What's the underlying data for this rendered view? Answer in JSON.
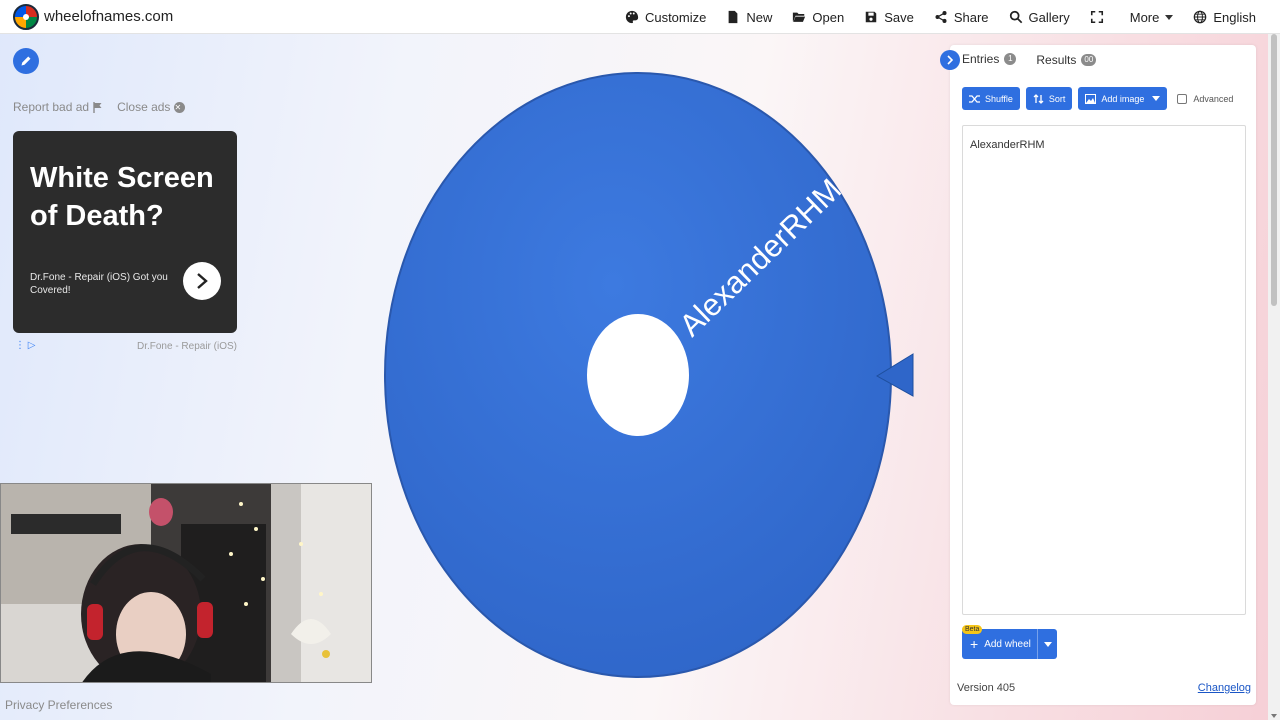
{
  "site": {
    "name": "wheelofnames.com"
  },
  "nav": {
    "customize": "Customize",
    "new": "New",
    "open": "Open",
    "save": "Save",
    "share": "Share",
    "gallery": "Gallery",
    "more": "More",
    "language": "English"
  },
  "ad": {
    "report": "Report bad ad",
    "close": "Close ads",
    "headline": "White Screen of Death?",
    "sub": "Dr.Fone - Repair (iOS) Got you Covered!",
    "advertiser": "Dr.Fone - Repair (iOS)"
  },
  "wheel": {
    "entry_label": "AlexanderRHM",
    "color": "#3b78d6"
  },
  "panel": {
    "tabs": [
      {
        "label": "Entries",
        "count": "1"
      },
      {
        "label": "Results",
        "count": "00"
      }
    ],
    "tools": {
      "shuffle": "Shuffle",
      "sort": "Sort",
      "add_image": "Add image",
      "advanced": "Advanced"
    },
    "entries": [
      "AlexanderRHM"
    ],
    "beta": "Beta",
    "add_wheel": "Add wheel",
    "version": "Version 405",
    "changelog": "Changelog"
  },
  "footer": {
    "privacy": "Privacy Preferences"
  },
  "colors": {
    "accent": "#2f6fe0",
    "wheel": "#3b78d6"
  }
}
